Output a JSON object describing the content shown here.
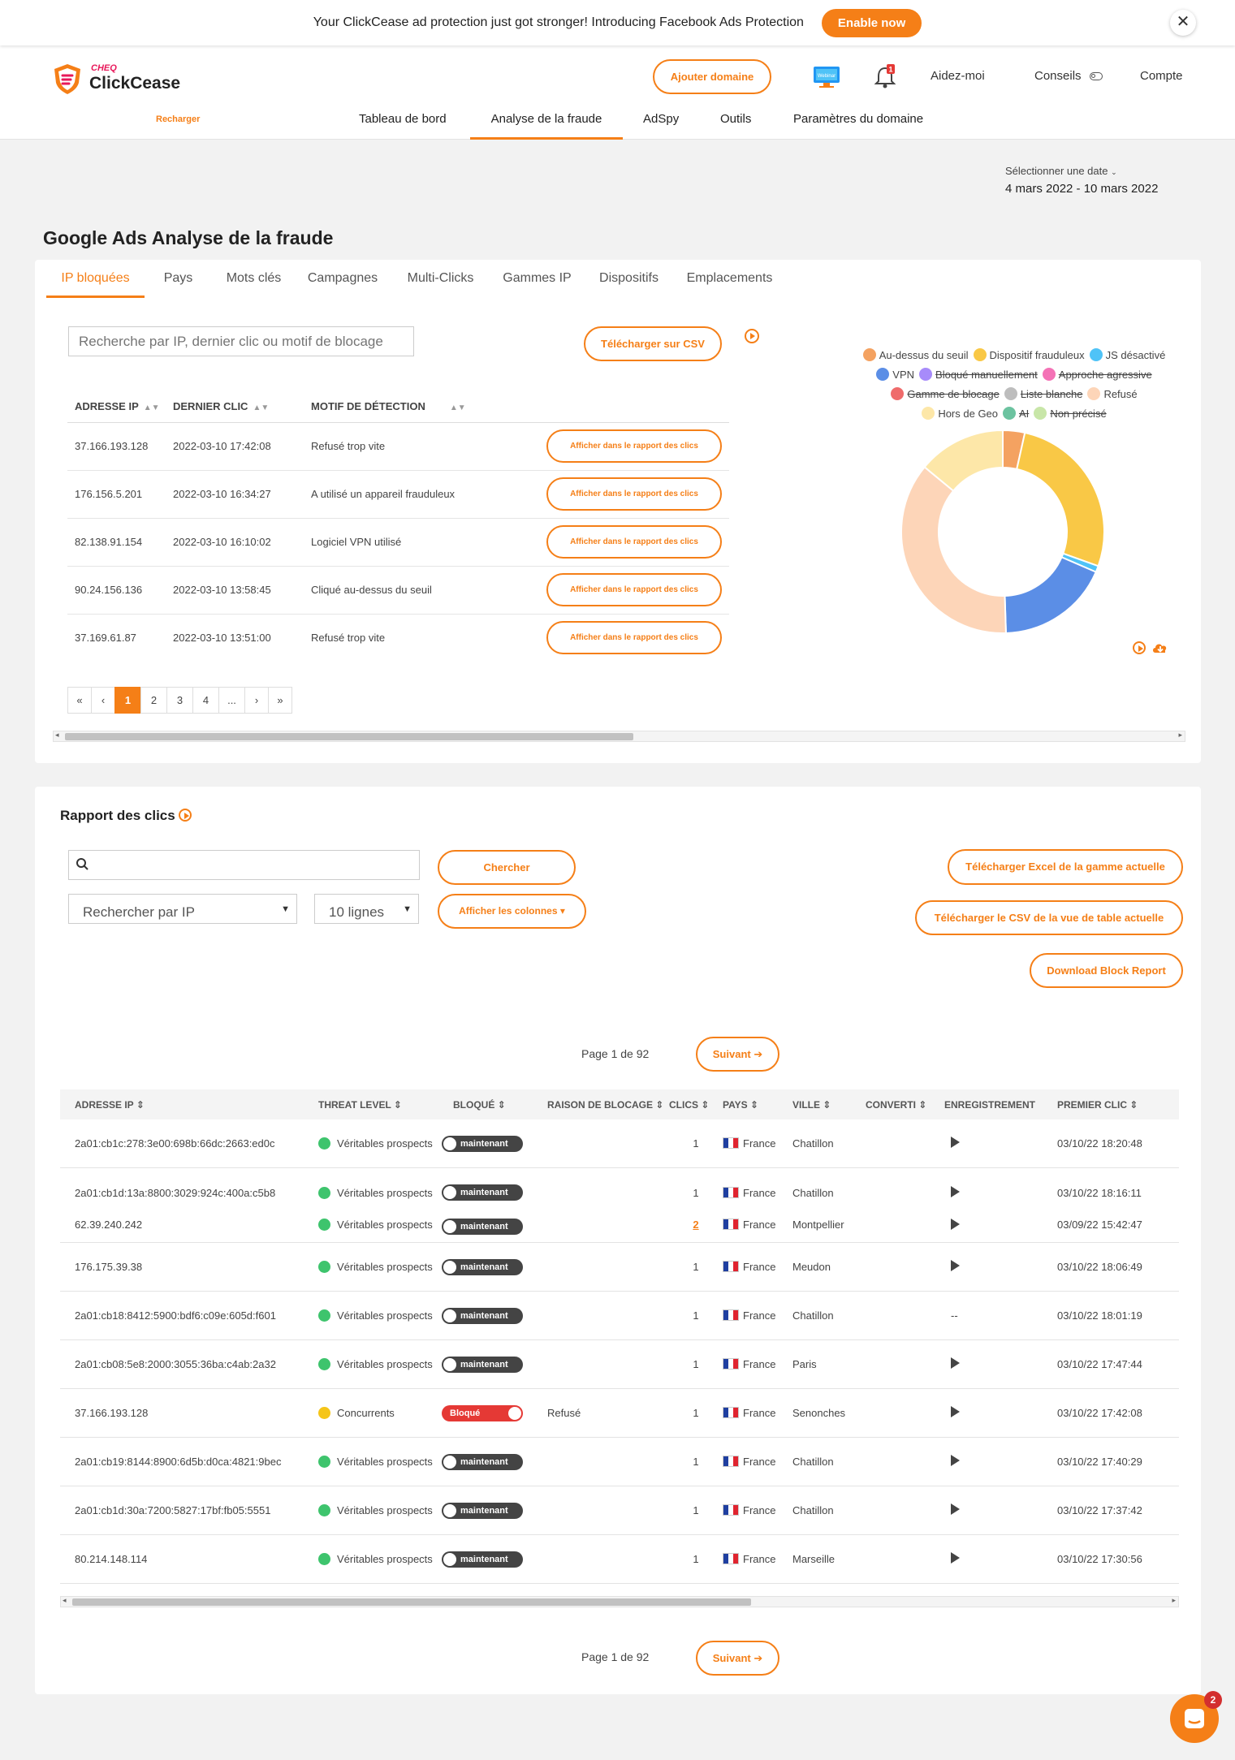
{
  "announcement": {
    "text": "Your ClickCease ad protection just got stronger! Introducing Facebook Ads Protection",
    "button": "Enable now",
    "close": "✕"
  },
  "brand": {
    "cheq": "CHEQ",
    "name": "ClickCease",
    "recharger": "Recharger",
    "accent": "#f57f17"
  },
  "header": {
    "add_domain": "Ajouter domaine",
    "webinar": "Webinar",
    "bell_badge": "1",
    "help": "Aidez-moi",
    "tips": "Conseils",
    "account": "Compte"
  },
  "nav": [
    "Tableau de bord",
    "Analyse de la fraude",
    "AdSpy",
    "Outils",
    "Paramètres du domaine"
  ],
  "date": {
    "label": "Sélectionner une date",
    "range": "4 mars 2022 - 10 mars 2022"
  },
  "page_title": "Google Ads Analyse de la fraude",
  "tabs": [
    "IP bloquées",
    "Pays",
    "Mots clés",
    "Campagnes",
    "Multi-Clicks",
    "Gammes IP",
    "Dispositifs",
    "Emplacements"
  ],
  "blocked": {
    "search_placeholder": "Recherche par IP, dernier clic ou motif de blocage",
    "csv_button": "Télécharger sur CSV",
    "headers": [
      "ADRESSE IP",
      "DERNIER CLIC",
      "MOTIF DE DÉTECTION"
    ],
    "report_button": "Afficher dans le rapport des clics",
    "rows": [
      {
        "ip": "37.166.193.128",
        "date": "2022-03-10 17:42:08",
        "reason": "Refusé trop vite"
      },
      {
        "ip": "176.156.5.201",
        "date": "2022-03-10 16:34:27",
        "reason": "A utilisé un appareil frauduleux"
      },
      {
        "ip": "82.138.91.154",
        "date": "2022-03-10 16:10:02",
        "reason": "Logiciel VPN utilisé"
      },
      {
        "ip": "90.24.156.136",
        "date": "2022-03-10 13:58:45",
        "reason": "Cliqué au-dessus du seuil"
      },
      {
        "ip": "37.169.61.87",
        "date": "2022-03-10 13:51:00",
        "reason": "Refusé trop vite"
      }
    ],
    "pager": [
      "«",
      "‹",
      "1",
      "2",
      "3",
      "4",
      "...",
      "›",
      "»"
    ]
  },
  "chart_data": {
    "type": "pie",
    "donut": true,
    "legend_position": "top",
    "legend": [
      {
        "name": "Au-dessus du seuil",
        "color": "#f4a261",
        "hidden": false
      },
      {
        "name": "Dispositif frauduleux",
        "color": "#f9c846",
        "hidden": false
      },
      {
        "name": "JS désactivé",
        "color": "#4fc3f7",
        "hidden": false
      },
      {
        "name": "VPN",
        "color": "#5b8ee6",
        "hidden": false
      },
      {
        "name": "Bloqué manuellement",
        "color": "#a78bfa",
        "hidden": true
      },
      {
        "name": "Approche agressive",
        "color": "#f472b6",
        "hidden": true
      },
      {
        "name": "Gamme de blocage",
        "color": "#ef6b6b",
        "hidden": true
      },
      {
        "name": "Liste blanche",
        "color": "#bdbdbd",
        "hidden": true
      },
      {
        "name": "Refusé",
        "color": "#fdd5b8",
        "hidden": false
      },
      {
        "name": "Hors de Geo",
        "color": "#fde7a8",
        "hidden": false
      },
      {
        "name": "AI",
        "color": "#6cc3a0",
        "hidden": true
      },
      {
        "name": "Non précisé",
        "color": "#c8e6a8",
        "hidden": true
      }
    ],
    "slices": [
      {
        "name": "Au-dessus du seuil",
        "value": 3.5,
        "color": "#f4a261"
      },
      {
        "name": "Dispositif frauduleux",
        "value": 27,
        "color": "#f9c846"
      },
      {
        "name": "JS désactivé",
        "value": 1,
        "color": "#4fc3f7"
      },
      {
        "name": "VPN",
        "value": 18,
        "color": "#5b8ee6"
      },
      {
        "name": "Refusé",
        "value": 36.5,
        "color": "#fdd5b8"
      },
      {
        "name": "Hors de Geo",
        "value": 14,
        "color": "#fde7a8"
      }
    ]
  },
  "clicks": {
    "title": "Rapport des clics",
    "search_button": "Chercher",
    "search_by": "Rechercher par IP",
    "lines": "10 lignes",
    "columns_button": "Afficher les colonnes ▾",
    "dl_excel": "Télécharger Excel de la gamme actuelle",
    "dl_csv": "Télécharger le CSV de la vue de table actuelle",
    "dl_block": "Download Block Report",
    "page_info": "Page 1 de 92",
    "next": "Suivant ➔",
    "headers": [
      "ADRESSE IP",
      "THREAT LEVEL",
      "BLOQUÉ",
      "RAISON DE BLOCAGE",
      "CLICS",
      "PAYS",
      "VILLE",
      "CONVERTI",
      "ENREGISTREMENT",
      "PREMIER CLIC"
    ],
    "rows": [
      {
        "ip": "2a01:cb1c:278:3e00:698b:66dc:2663:ed0c",
        "threat": "Véritables prospects",
        "threat_color": "#3ec46d",
        "block": "maintenant",
        "blocked": false,
        "reason": "",
        "clicks": "1",
        "link": false,
        "country": "France",
        "city": "Chatillon",
        "rec": "play",
        "first": "03/10/22 18:20:48"
      },
      {
        "ip": "2a01:cb1d:13a:8800:3029:924c:400a:c5b8",
        "threat": "Véritables prospects",
        "threat_color": "#3ec46d",
        "block": "maintenant",
        "blocked": false,
        "reason": "",
        "clicks": "1",
        "link": false,
        "country": "France",
        "city": "Chatillon",
        "rec": "play",
        "first": "03/10/22 18:16:11"
      },
      {
        "ip": "62.39.240.242",
        "threat": "Véritables prospects",
        "threat_color": "#3ec46d",
        "block": "maintenant",
        "blocked": false,
        "reason": "",
        "clicks": "2",
        "link": true,
        "country": "France",
        "city": "Montpellier",
        "rec": "play",
        "first": "03/09/22 15:42:47"
      },
      {
        "ip": "176.175.39.38",
        "threat": "Véritables prospects",
        "threat_color": "#3ec46d",
        "block": "maintenant",
        "blocked": false,
        "reason": "",
        "clicks": "1",
        "link": false,
        "country": "France",
        "city": "Meudon",
        "rec": "play",
        "first": "03/10/22 18:06:49"
      },
      {
        "ip": "2a01:cb18:8412:5900:bdf6:c09e:605d:f601",
        "threat": "Véritables prospects",
        "threat_color": "#3ec46d",
        "block": "maintenant",
        "blocked": false,
        "reason": "",
        "clicks": "1",
        "link": false,
        "country": "France",
        "city": "Chatillon",
        "rec": "--",
        "first": "03/10/22 18:01:19"
      },
      {
        "ip": "2a01:cb08:5e8:2000:3055:36ba:c4ab:2a32",
        "threat": "Véritables prospects",
        "threat_color": "#3ec46d",
        "block": "maintenant",
        "blocked": false,
        "reason": "",
        "clicks": "1",
        "link": false,
        "country": "France",
        "city": "Paris",
        "rec": "play",
        "first": "03/10/22 17:47:44"
      },
      {
        "ip": "37.166.193.128",
        "threat": "Concurrents",
        "threat_color": "#f5c518",
        "block": "Bloqué",
        "blocked": true,
        "reason": "Refusé",
        "clicks": "1",
        "link": false,
        "country": "France",
        "city": "Senonches",
        "rec": "play",
        "first": "03/10/22 17:42:08"
      },
      {
        "ip": "2a01:cb19:8144:8900:6d5b:d0ca:4821:9bec",
        "threat": "Véritables prospects",
        "threat_color": "#3ec46d",
        "block": "maintenant",
        "blocked": false,
        "reason": "",
        "clicks": "1",
        "link": false,
        "country": "France",
        "city": "Chatillon",
        "rec": "play",
        "first": "03/10/22 17:40:29"
      },
      {
        "ip": "2a01:cb1d:30a:7200:5827:17bf:fb05:5551",
        "threat": "Véritables prospects",
        "threat_color": "#3ec46d",
        "block": "maintenant",
        "blocked": false,
        "reason": "",
        "clicks": "1",
        "link": false,
        "country": "France",
        "city": "Chatillon",
        "rec": "play",
        "first": "03/10/22 17:37:42"
      },
      {
        "ip": "80.214.148.114",
        "threat": "Véritables prospects",
        "threat_color": "#3ec46d",
        "block": "maintenant",
        "blocked": false,
        "reason": "",
        "clicks": "1",
        "link": false,
        "country": "France",
        "city": "Marseille",
        "rec": "play",
        "first": "03/10/22 17:30:56"
      }
    ]
  },
  "chat_badge": "2"
}
